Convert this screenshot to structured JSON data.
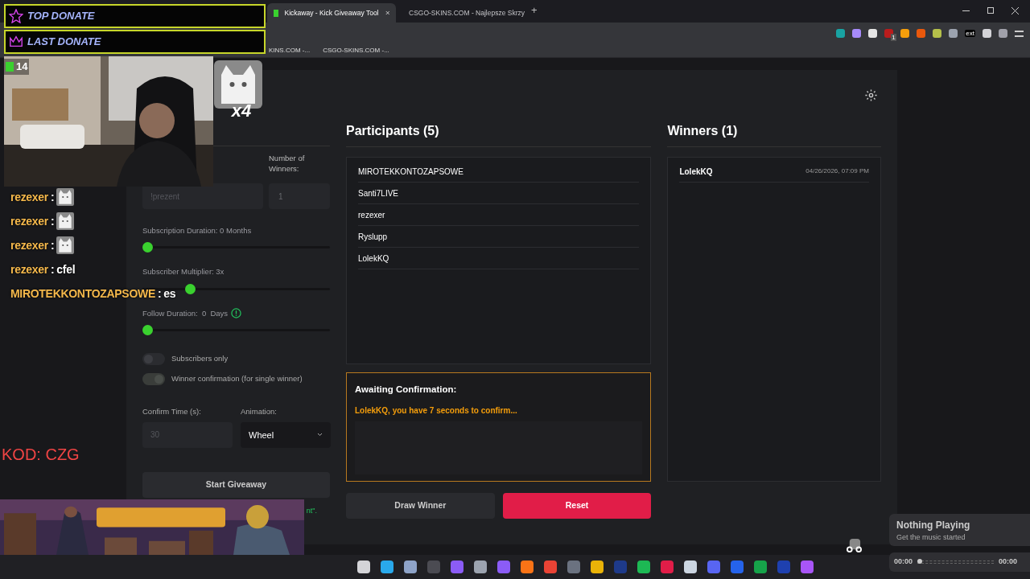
{
  "browser": {
    "tabs": [
      {
        "title": "Kickaway - Kick Giveaway Tool",
        "selected": true
      },
      {
        "title": "CSGO-SKINS.COM - Najlepsze Skrzy",
        "selected": false
      }
    ],
    "new_tab": "+",
    "extension_badge": "1",
    "extension_label": "ext",
    "bookmarks": [
      "KINS.COM -...",
      "CSGO-SKINS.COM -..."
    ]
  },
  "settings": {
    "winners_label": "Number of Winners:",
    "keyword_placeholder": "!prezent",
    "winners_value": "1",
    "sliders": [
      {
        "label": "Subscription Duration: 0 Months",
        "level": 0,
        "kind": "plain"
      },
      {
        "label": "Subscriber Multiplier: 3x",
        "level": 0.24,
        "kind": "plain"
      },
      {
        "label": "Follow Duration:  0  Days",
        "level": 0,
        "kind": "info"
      }
    ],
    "toggles": [
      {
        "label": "Subscribers only",
        "on": false
      },
      {
        "label": "Winner confirmation (for single winner)",
        "on": true
      }
    ],
    "confirm_label": "Confirm Time (s):",
    "confirm_placeholder": "30",
    "animation_label": "Animation:",
    "animation_value": "Wheel",
    "start_button": "Start Giveaway",
    "hint_fragment": "nt\"."
  },
  "participants": {
    "title": "Participants (5)",
    "names": [
      "MIROTEKKONTOZAPSOWE",
      "Santi7LIVE",
      "rezexer",
      "Ryslupp",
      "LolekKQ"
    ]
  },
  "confirmation": {
    "title": "Awaiting Confirmation:",
    "message": "LolekKQ, you have 7 seconds to confirm..."
  },
  "draw_button": "Draw Winner",
  "reset_button": "Reset",
  "winners": {
    "title": "Winners (1)",
    "items": [
      {
        "name": "LolekKQ",
        "time": "04/26/2026, 07:09 PM"
      }
    ]
  },
  "overlay": {
    "donations": [
      "TOP DONATE",
      "LAST DONATE"
    ],
    "viewers": "14",
    "emote_count": "x4",
    "chat": [
      {
        "user": "rezexer",
        "sep": ":",
        "kind": "emote"
      },
      {
        "user": "rezexer",
        "sep": ":",
        "kind": "emote"
      },
      {
        "user": "rezexer",
        "sep": ":",
        "kind": "emote"
      },
      {
        "user": "rezexer",
        "sep": ":",
        "kind": "text",
        "text": "cfel"
      },
      {
        "user": "MIROTEKKONTOZAPSOWE",
        "sep": ":",
        "kind": "text",
        "text": "es"
      }
    ],
    "code": "KOD: CZG",
    "media": {
      "title": "Nothing Playing",
      "subtitle": "Get the music started",
      "elapsed": "00:00",
      "total": "00:00",
      "level": 0
    }
  }
}
